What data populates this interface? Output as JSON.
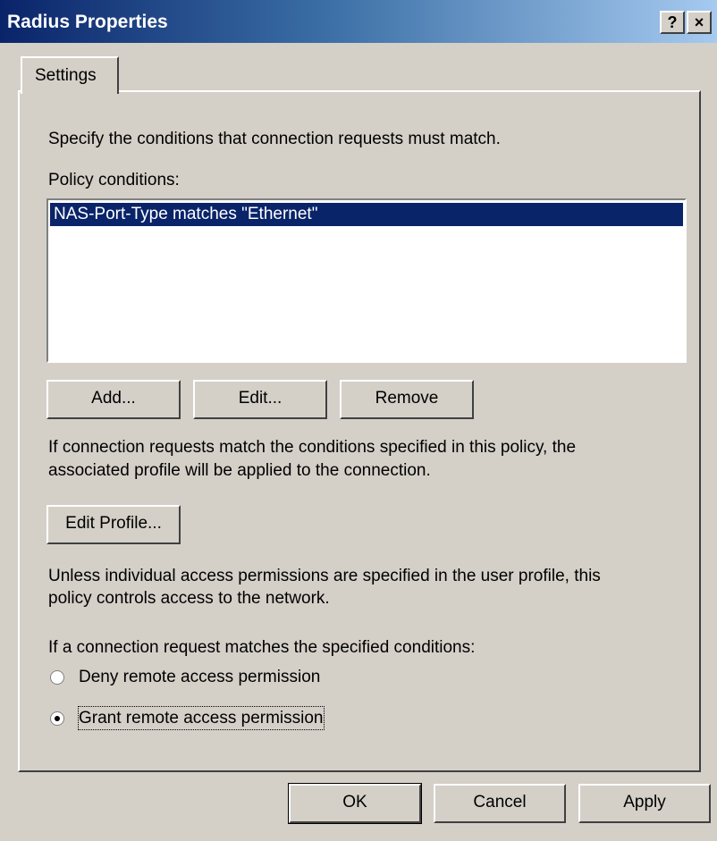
{
  "window": {
    "title": "Radius Properties",
    "help_glyph": "?",
    "close_glyph": "×"
  },
  "tabs": [
    {
      "label": "Settings"
    }
  ],
  "settings": {
    "intro_text": "Specify the conditions that connection requests must match.",
    "conditions_label": "Policy conditions:",
    "conditions": [
      "NAS-Port-Type matches \"Ethernet\""
    ],
    "add_label": "Add...",
    "edit_label": "Edit...",
    "remove_label": "Remove",
    "profile_text_line1": "If connection requests match the conditions specified in this policy, the",
    "profile_text_line2": "associated profile will be applied to the connection.",
    "edit_profile_label": "Edit Profile...",
    "permissions_text_line1": "Unless individual access permissions are specified in the user profile, this",
    "permissions_text_line2": "policy controls access to the network.",
    "match_label": "If a connection request matches the specified conditions:",
    "deny_label": "Deny remote access permission",
    "grant_label": "Grant remote access permission",
    "selected_permission": "grant"
  },
  "footer": {
    "ok_label": "OK",
    "cancel_label": "Cancel",
    "apply_label": "Apply"
  },
  "colors": {
    "face": "#d4d0c8",
    "title_start": "#0a246a",
    "title_end": "#a6caf0",
    "selection": "#0a246a"
  }
}
